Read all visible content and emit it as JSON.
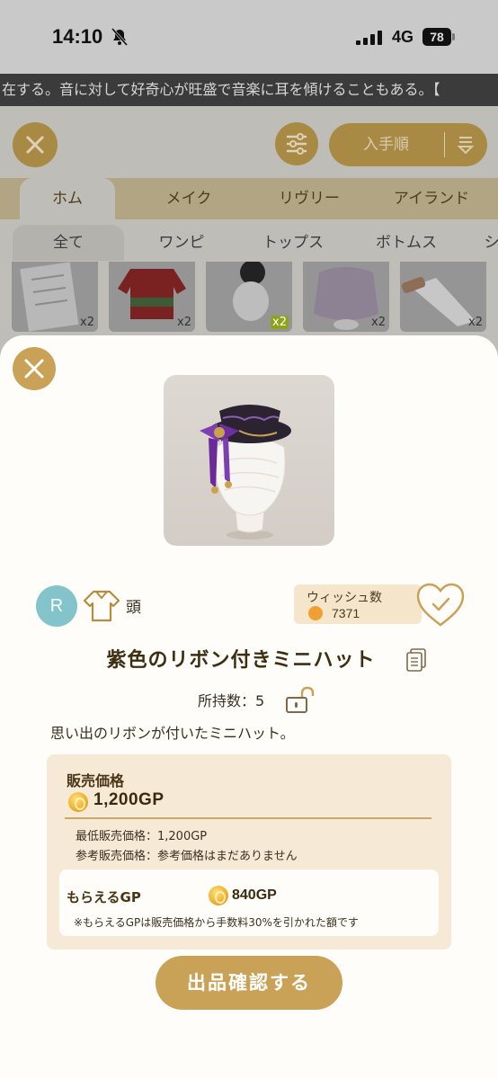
{
  "status_bar": {
    "time": "14:10",
    "network": "4G",
    "battery": "78"
  },
  "marquee": {
    "text": "在する。音に対して好奇心が旺盛で音楽に耳を傾けることもある。【"
  },
  "toolbar": {
    "sort_label": "入手順"
  },
  "tabs_primary": [
    "ホム",
    "メイク",
    "リヴリー",
    "アイランド"
  ],
  "tabs_secondary": [
    "全て",
    "ワンピ",
    "トップス",
    "ボトムス",
    "シ"
  ],
  "thumbnails": [
    {
      "count": "x2"
    },
    {
      "count": "x2"
    },
    {
      "count": "x2"
    },
    {
      "count": "x2"
    },
    {
      "count": "x2"
    }
  ],
  "item": {
    "rarity": "R",
    "category": "頭",
    "wish_label": "ウィッシュ数",
    "wish_count": "7371",
    "name": "紫色のリボン付きミニハット",
    "owned": "所持数：5",
    "description": "思い出のリボンが付いたミニハット。"
  },
  "price": {
    "title": "販売価格",
    "value": "1,200GP",
    "min_price": "最低販売価格：1,200GP",
    "ref_price": "参考販売価格：参考価格はまだありません",
    "receive_label": "もらえるGP",
    "receive_value": "840GP",
    "receive_note": "※もらえるGPは販売価格から手数料30%を引かれた額です"
  },
  "submit_label": "出品確認する",
  "colors": {
    "gold": "#c9a257",
    "teal": "#82c4c9",
    "panel": "#f6ead6"
  }
}
